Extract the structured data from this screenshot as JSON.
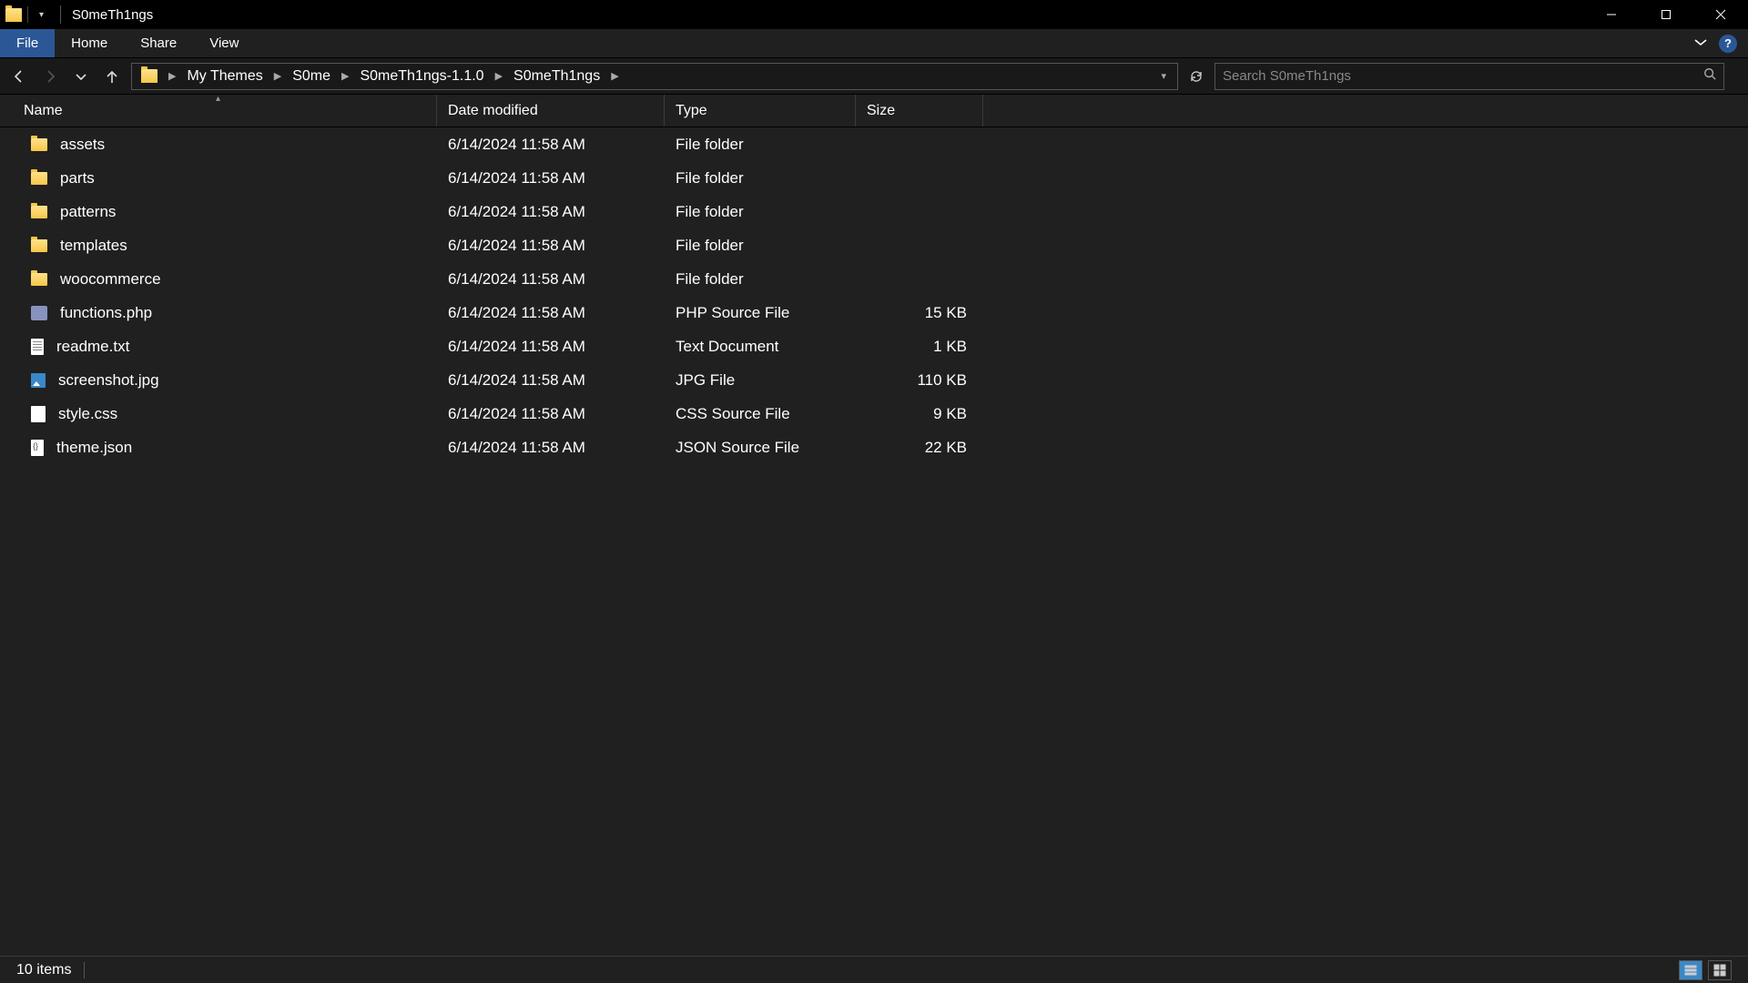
{
  "window": {
    "title": "S0meTh1ngs"
  },
  "ribbon": {
    "file": "File",
    "home": "Home",
    "share": "Share",
    "view": "View"
  },
  "breadcrumb": [
    "My Themes",
    "S0me",
    "S0meTh1ngs-1.1.0",
    "S0meTh1ngs"
  ],
  "search": {
    "placeholder": "Search S0meTh1ngs"
  },
  "columns": {
    "name": "Name",
    "date": "Date modified",
    "type": "Type",
    "size": "Size"
  },
  "items": [
    {
      "icon": "folder",
      "name": "assets",
      "date": "6/14/2024 11:58 AM",
      "type": "File folder",
      "size": ""
    },
    {
      "icon": "folder",
      "name": "parts",
      "date": "6/14/2024 11:58 AM",
      "type": "File folder",
      "size": ""
    },
    {
      "icon": "folder",
      "name": "patterns",
      "date": "6/14/2024 11:58 AM",
      "type": "File folder",
      "size": ""
    },
    {
      "icon": "folder",
      "name": "templates",
      "date": "6/14/2024 11:58 AM",
      "type": "File folder",
      "size": ""
    },
    {
      "icon": "folder",
      "name": "woocommerce",
      "date": "6/14/2024 11:58 AM",
      "type": "File folder",
      "size": ""
    },
    {
      "icon": "php",
      "name": "functions.php",
      "date": "6/14/2024 11:58 AM",
      "type": "PHP Source File",
      "size": "15 KB"
    },
    {
      "icon": "doc",
      "name": "readme.txt",
      "date": "6/14/2024 11:58 AM",
      "type": "Text Document",
      "size": "1 KB"
    },
    {
      "icon": "jpg",
      "name": "screenshot.jpg",
      "date": "6/14/2024 11:58 AM",
      "type": "JPG File",
      "size": "110 KB"
    },
    {
      "icon": "css",
      "name": "style.css",
      "date": "6/14/2024 11:58 AM",
      "type": "CSS Source File",
      "size": "9 KB"
    },
    {
      "icon": "json",
      "name": "theme.json",
      "date": "6/14/2024 11:58 AM",
      "type": "JSON Source File",
      "size": "22 KB"
    }
  ],
  "status": {
    "count": "10 items"
  }
}
